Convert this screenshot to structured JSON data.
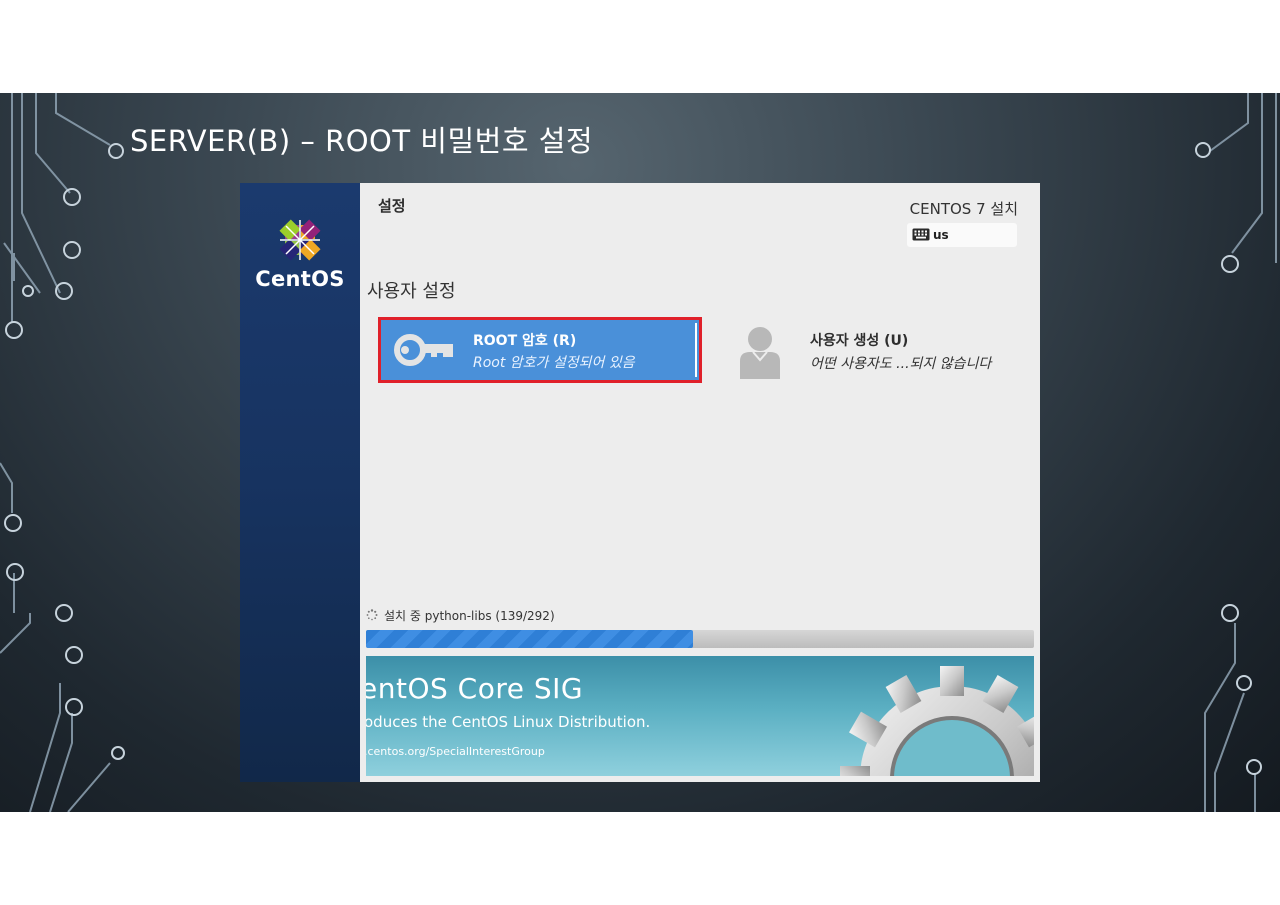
{
  "slide": {
    "title": "SERVER(B) – ROOT 비밀번호 설정"
  },
  "installer": {
    "sidebar": {
      "logo_text": "CentOS",
      "logo_icon": "centos-logo-icon"
    },
    "header": {
      "title": "설정",
      "install_title": "CENTOS 7 설치",
      "keyboard_layout": "us",
      "keyboard_icon": "keyboard-icon"
    },
    "section": {
      "title": "사용자 설정"
    },
    "spokes": [
      {
        "title": "ROOT 암호 (R)",
        "status": "Root 암호가 설정되어 있음",
        "icon": "key-icon",
        "selected": true,
        "highlight_color": "#e0202a",
        "background_color": "#4a90d9"
      },
      {
        "title": "사용자 생성 (U)",
        "status": "어떤 사용자도 ...되지 않습니다",
        "icon": "user-icon",
        "selected": false
      }
    ],
    "progress": {
      "text": "설치 중 python-libs (139/292)",
      "current": 139,
      "total": 292,
      "fraction": 0.49
    },
    "banner": {
      "title": "entOS Core SIG",
      "subtitle": "oduces the CentOS Linux Distribution.",
      "url": ".centos.org/SpecialInterestGroup",
      "icon": "gear-icon"
    }
  }
}
